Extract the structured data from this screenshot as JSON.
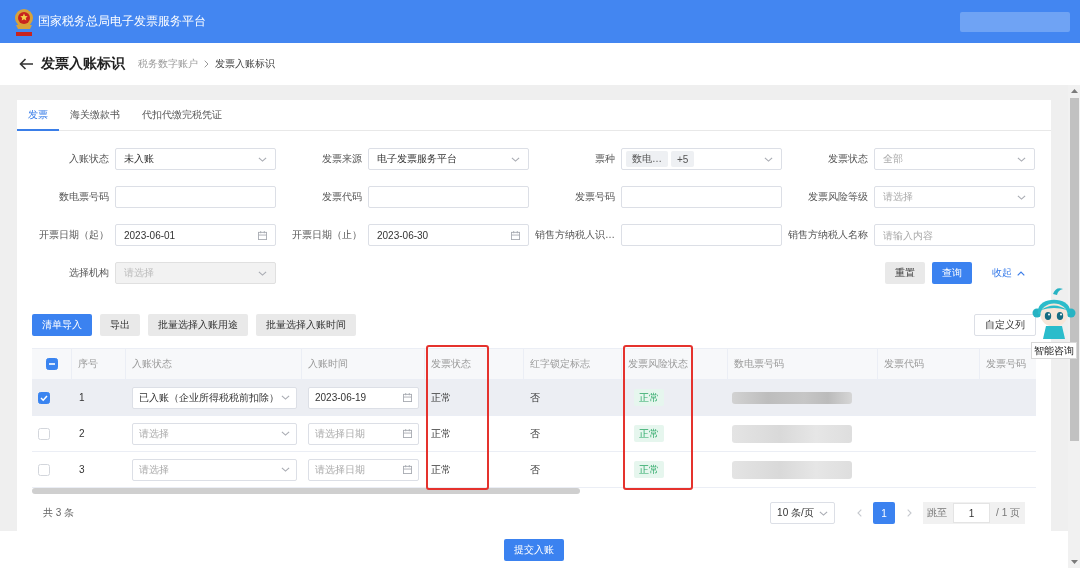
{
  "header": {
    "title": "国家税务总局电子发票服务平台",
    "user_redacted": true
  },
  "page": {
    "title": "发票入账标识",
    "breadcrumb": [
      {
        "label": "税务数字账户",
        "current": false
      },
      {
        "label": "发票入账标识",
        "current": true
      }
    ]
  },
  "tabs": [
    {
      "label": "发票",
      "selected": true
    },
    {
      "label": "海关缴款书",
      "selected": false
    },
    {
      "label": "代扣代缴完税凭证",
      "selected": false
    }
  ],
  "filters": [
    {
      "label": "入账状态",
      "kind": "select",
      "value": "未入账",
      "disabled": false
    },
    {
      "label": "发票来源",
      "kind": "select",
      "value": "电子发票服务平台",
      "disabled": false
    },
    {
      "label": "票种",
      "kind": "tags",
      "tags": [
        "数电…",
        "+5"
      ],
      "disabled": false
    },
    {
      "label": "发票状态",
      "kind": "select",
      "placeholder": "全部",
      "disabled": false
    },
    {
      "label": "数电票号码",
      "kind": "text",
      "disabled": false
    },
    {
      "label": "发票代码",
      "kind": "text",
      "disabled": false
    },
    {
      "label": "发票号码",
      "kind": "text",
      "disabled": false
    },
    {
      "label": "发票风险等级",
      "kind": "select",
      "placeholder": "请选择",
      "disabled": false
    },
    {
      "label": "开票日期（起）",
      "kind": "date",
      "value": "2023-06-01",
      "disabled": false
    },
    {
      "label": "开票日期（止）",
      "kind": "date",
      "value": "2023-06-30",
      "disabled": false
    },
    {
      "label": "销售方纳税人识…",
      "kind": "text",
      "disabled": false
    },
    {
      "label": "销售方纳税人名称",
      "kind": "text",
      "placeholder": "请输入内容",
      "disabled": false
    },
    {
      "label": "选择机构",
      "kind": "select",
      "placeholder": "请选择",
      "disabled": true
    }
  ],
  "filter_actions": [
    {
      "label": "重置",
      "kind": "default"
    },
    {
      "label": "查询",
      "kind": "primary"
    },
    {
      "label": "收起",
      "kind": "link"
    }
  ],
  "toolbar": {
    "buttons": [
      {
        "label": "清单导入",
        "kind": "primary"
      },
      {
        "label": "导出",
        "kind": "default"
      },
      {
        "label": "批量选择入账用途",
        "kind": "default"
      },
      {
        "label": "批量选择入账时间",
        "kind": "default"
      }
    ],
    "right_buttons": [
      {
        "label": "自定义列",
        "kind": "plain"
      }
    ]
  },
  "table": {
    "all_selected": false,
    "partly_selected": true,
    "columns": [
      {
        "label": "序号",
        "kind": "index",
        "highlighted": false
      },
      {
        "label": "入账状态",
        "kind": "select",
        "highlighted": false
      },
      {
        "label": "入账时间",
        "kind": "date",
        "highlighted": false
      },
      {
        "label": "发票状态",
        "kind": "text",
        "highlighted": true
      },
      {
        "label": "红字锁定标志",
        "kind": "text",
        "highlighted": false
      },
      {
        "label": "发票风险状态",
        "kind": "tag",
        "highlighted": true
      },
      {
        "label": "数电票号码",
        "kind": "redacted",
        "highlighted": false
      },
      {
        "label": "发票代码",
        "kind": "text",
        "highlighted": false
      },
      {
        "label": "发票号码",
        "kind": "text",
        "highlighted": false
      }
    ],
    "rows": [
      {
        "selected": true,
        "cells": [
          {
            "text": "1"
          },
          {
            "value": "已入账（企业所得税税前扣除）"
          },
          {
            "value": "2023-06-19"
          },
          {
            "text": "正常"
          },
          {
            "text": "否"
          },
          {
            "text": "正常"
          },
          {
            "redacted": true
          }
        ]
      },
      {
        "selected": false,
        "cells": [
          {
            "text": "2"
          },
          {
            "placeholder": "请选择"
          },
          {
            "placeholder": "请选择日期"
          },
          {
            "text": "正常"
          },
          {
            "text": "否"
          },
          {
            "text": "正常"
          },
          {
            "redacted": true
          }
        ]
      },
      {
        "selected": false,
        "cells": [
          {
            "text": "3"
          },
          {
            "placeholder": "请选择"
          },
          {
            "placeholder": "请选择日期"
          },
          {
            "text": "正常"
          },
          {
            "text": "否"
          },
          {
            "text": "正常"
          },
          {
            "redacted": true
          }
        ]
      }
    ]
  },
  "pagination": {
    "total": "共 3 条",
    "page_size": "10 条/页",
    "prev_disabled": true,
    "pages": [
      {
        "label": "1",
        "selected": true
      }
    ],
    "next_disabled": true,
    "jump_label": "跳至",
    "jump_value": "1",
    "page_count": "/ 1 页"
  },
  "assistant": {
    "label": "智能咨询"
  },
  "footer": {
    "submit": "提交入账"
  }
}
